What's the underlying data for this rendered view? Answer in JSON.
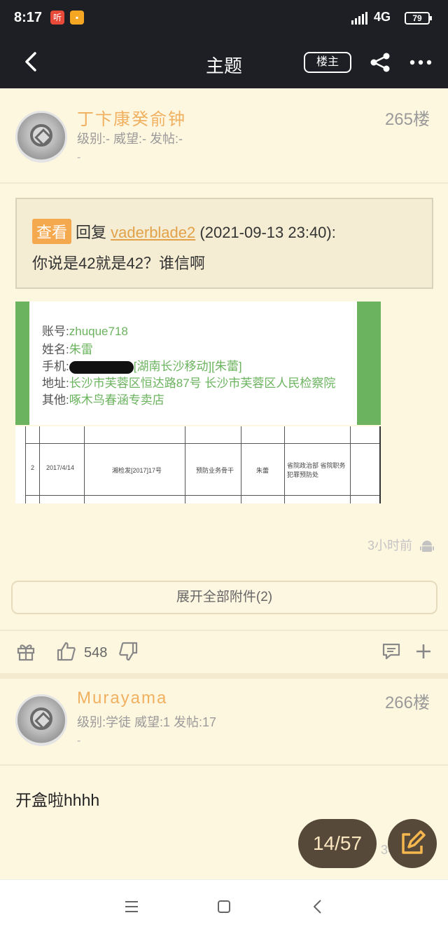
{
  "status_bar": {
    "time": "8:17",
    "app_icon_1": "听",
    "app_icon_2": "▪",
    "network": "4G",
    "battery": "79"
  },
  "nav": {
    "title": "主题",
    "owner_button": "楼主",
    "back_icon": "chevron-left-icon",
    "share_icon": "share-icon",
    "more_icon": "more-dots-icon"
  },
  "post1": {
    "username": "丁卞康癸俞钟",
    "stats": "级别:- 威望:- 发帖:-",
    "signature": "-",
    "floor": "265楼",
    "quote": {
      "view_tag": "查看",
      "reply_word": "回复",
      "user": "vaderblade2",
      "datetime": "(2021-09-13 23:40):",
      "text": "你说是42就是42？谁信啊"
    },
    "image_lines": [
      {
        "label": "账号:",
        "value": "zhuque718"
      },
      {
        "label": "姓名:",
        "value": "朱雷"
      },
      {
        "label": "手机:",
        "value": "[湖南长沙移动][朱蕾]"
      },
      {
        "label": "地址:",
        "value": "长沙市芙蓉区恒达路87号  长沙市芙蓉区人民检察院"
      },
      {
        "label": "其他:",
        "value": "啄木鸟春涵专卖店"
      }
    ],
    "table_row": [
      "2",
      "2017/4/14",
      "湘检发[2017]17号",
      "预防业务骨干",
      "朱蕾",
      "省院政治部 省院职务犯罪预防处"
    ],
    "time_ago": "3小时前",
    "attach_button": "展开全部附件(2)",
    "likes": "548"
  },
  "post2": {
    "username": "Murayama",
    "stats": "级别:学徒 威望:1 发帖:17",
    "signature": "-",
    "floor": "266楼",
    "body": "开盒啦hhhh",
    "peek_time": "3小"
  },
  "pager": {
    "label": "14/57"
  }
}
